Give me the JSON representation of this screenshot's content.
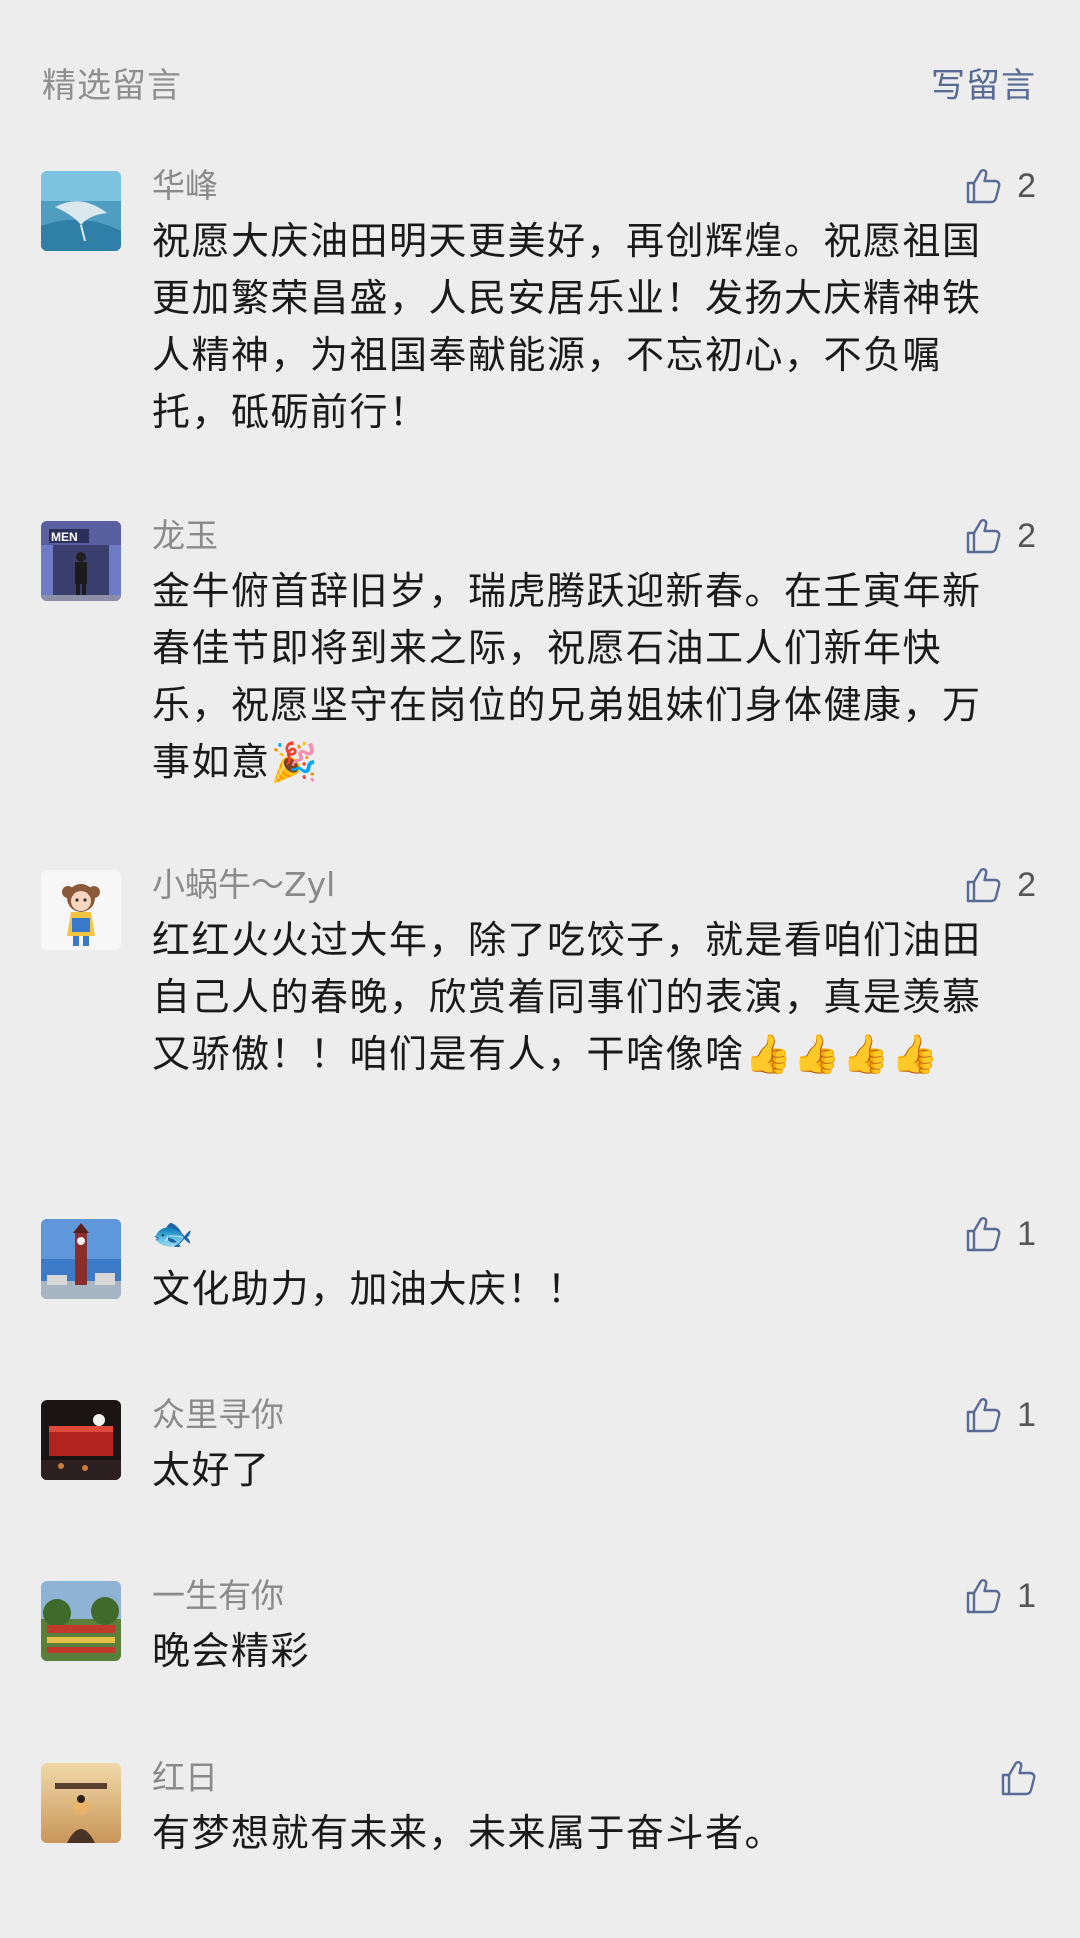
{
  "header": {
    "title": "精选留言",
    "write_label": "写留言"
  },
  "comments": [
    {
      "nickname": "华峰",
      "text": "祝愿大庆油田明天更美好，再创辉煌。祝愿祖国更加繁荣昌盛，人民安居乐业！发扬大庆精神铁人精神，为祖国奉献能源，不忘初心，不负嘱托，砥砺前行！",
      "likes": "2",
      "avatar_icon": "manta-ray-ocean-avatar"
    },
    {
      "nickname": "龙玉",
      "text": "金牛俯首辞旧岁，瑞虎腾跃迎新春。在壬寅年新春佳节即将到来之际，祝愿石油工人们新年快乐，祝愿坚守在岗位的兄弟姐妹们身体健康，万事如意🎉",
      "likes": "2",
      "avatar_icon": "men-sign-person-avatar"
    },
    {
      "nickname": "小蜗牛～Zyl",
      "text": "红红火火过大年，除了吃饺子，就是看咱们油田自己人的春晚，欣赏着同事们的表演，真是羡慕又骄傲！！咱们是有人，干啥像啥👍👍👍👍",
      "likes": "2",
      "avatar_icon": "cartoon-girl-avatar"
    },
    {
      "nickname": "🐟",
      "text": "文化助力，加油大庆！！",
      "likes": "1",
      "avatar_icon": "clock-tower-avatar"
    },
    {
      "nickname": "众里寻你",
      "text": "太好了",
      "likes": "1",
      "avatar_icon": "stage-lights-avatar"
    },
    {
      "nickname": "一生有你",
      "text": "晚会精彩",
      "likes": "1",
      "avatar_icon": "garden-scene-avatar"
    },
    {
      "nickname": "红日",
      "text": "有梦想就有未来，未来属于奋斗者。",
      "likes": "",
      "avatar_icon": "sunset-figure-avatar"
    }
  ],
  "colors": {
    "background": "#ededed",
    "link": "#576b95",
    "muted": "#8a8a8a",
    "text": "#1a1a1a"
  }
}
